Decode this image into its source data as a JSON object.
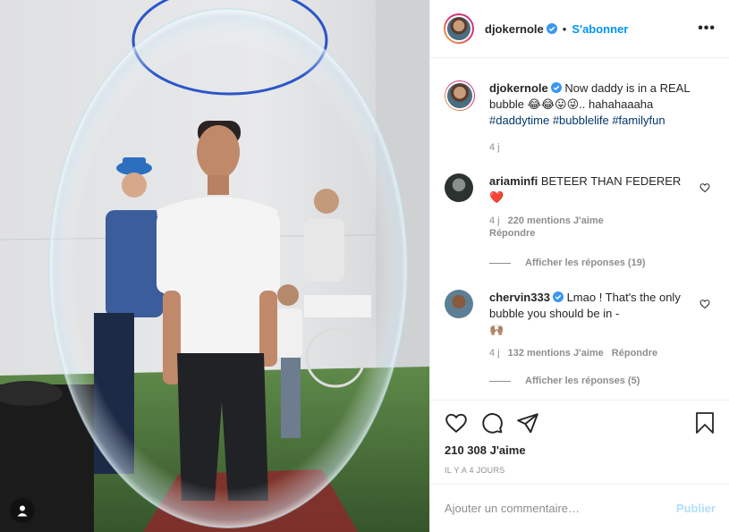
{
  "post": {
    "author": "djokernole",
    "follow_label": "S'abonner",
    "dot": "•",
    "more_label": "•••",
    "caption": {
      "author": "djokernole",
      "text": "Now daddy is in a REAL bubble 😂😂😛😜.. hahahaaaha",
      "hashtags": "#daddytime #bubblelife #familyfun",
      "time": "4 j"
    },
    "likes": "210 308 J'aime",
    "time_ago": "IL Y A 4 JOURS"
  },
  "comments": [
    {
      "author": "ariaminfi",
      "text": "BETEER THAN FEDERER",
      "emoji": "❤️",
      "time": "4 j",
      "likes": "220 mentions J'aime",
      "reply_label": "Répondre",
      "view_replies": "Afficher les réponses (19)"
    },
    {
      "author": "chervin333",
      "text": "Lmao ! That's the only bubble you should be in -",
      "emoji": "🙌🏽",
      "time": "4 j",
      "likes": "132 mentions J'aime",
      "reply_label": "Répondre",
      "view_replies": "Afficher les réponses (5)"
    }
  ],
  "composer": {
    "placeholder": "Ajouter un commentaire…",
    "publish_label": "Publier"
  },
  "icons": {
    "like": "heart-icon",
    "comment": "comment-icon",
    "share": "paper-plane-icon",
    "save": "bookmark-icon",
    "more": "more-options-icon",
    "verified": "verified-badge-icon",
    "tag": "user-tag-icon"
  },
  "colors": {
    "accent_blue": "#0095f6",
    "hashtag_blue": "#00376b",
    "muted_gray": "#8e8e8e",
    "publish_disabled": "#b2dffc",
    "divider": "#efefef"
  }
}
